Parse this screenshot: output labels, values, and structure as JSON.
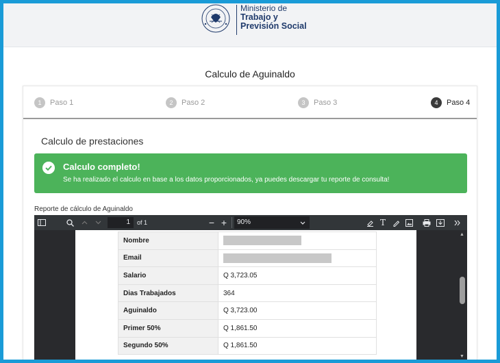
{
  "header": {
    "seal_text_top": "REPUBLICA DE",
    "seal_text_bottom": "GUATEMALA",
    "logo_line1": "Ministerio de",
    "logo_line2": "Trabajo y",
    "logo_line3": "Previsión Social",
    "brand_color": "#1f3a6b"
  },
  "page_title": "Calculo de Aguinaldo",
  "steps": [
    {
      "num": "1",
      "label": "Paso 1"
    },
    {
      "num": "2",
      "label": "Paso 2"
    },
    {
      "num": "3",
      "label": "Paso 3"
    },
    {
      "num": "4",
      "label": "Paso 4"
    }
  ],
  "section_title": "Calculo de prestaciones",
  "alert": {
    "title": "Calculo completo!",
    "text": "Se ha realizado el calculo en base a los datos proporcionados, ya puedes descargar tu reporte de consulta!",
    "color": "#4cb35a"
  },
  "report_label": "Reporte de cálculo de Aguinaldo",
  "viewer": {
    "page_current": "1",
    "page_of": "of 1",
    "zoom": "90%"
  },
  "report_rows": [
    {
      "key": "Nombre",
      "value": ""
    },
    {
      "key": "Email",
      "value": ""
    },
    {
      "key": "Salario",
      "value": "Q 3,723.05"
    },
    {
      "key": "Dias Trabajados",
      "value": "364"
    },
    {
      "key": "Aguinaldo",
      "value": "Q 3,723.00"
    },
    {
      "key": "Primer 50%",
      "value": "Q 1,861.50"
    },
    {
      "key": "Segundo 50%",
      "value": "Q 1,861.50"
    }
  ]
}
